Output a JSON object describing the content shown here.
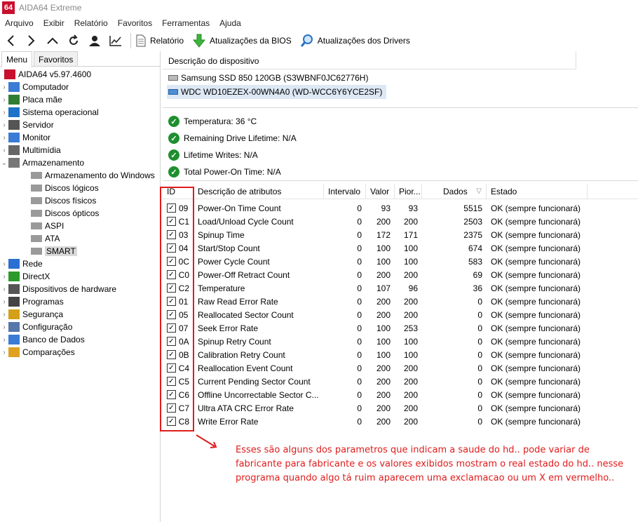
{
  "app": {
    "icon_text": "64",
    "title": "AIDA64 Extreme"
  },
  "menu": [
    "Arquivo",
    "Exibir",
    "Relatório",
    "Favoritos",
    "Ferramentas",
    "Ajuda"
  ],
  "toolbar": {
    "report_label": "Relatório",
    "bios_label": "Atualizações da BIOS",
    "drivers_label": "Atualizações dos Drivers"
  },
  "left_tabs": [
    "Menu",
    "Favoritos"
  ],
  "tree": {
    "root": "AIDA64 v5.97.4600",
    "items": [
      {
        "label": "Computador",
        "icon": "computer-icon",
        "color": "#3a7bd5"
      },
      {
        "label": "Placa mãe",
        "icon": "motherboard-icon",
        "color": "#2f7d32"
      },
      {
        "label": "Sistema operacional",
        "icon": "windows-icon",
        "color": "#1e73c8"
      },
      {
        "label": "Servidor",
        "icon": "server-icon",
        "color": "#555555"
      },
      {
        "label": "Monitor",
        "icon": "monitor-icon",
        "color": "#3a7bd5"
      },
      {
        "label": "Multimídia",
        "icon": "speaker-icon",
        "color": "#666666"
      },
      {
        "label": "Armazenamento",
        "icon": "storage-icon",
        "color": "#777777"
      }
    ],
    "storage_children": [
      "Armazenamento do Windows",
      "Discos lógicos",
      "Discos físicos",
      "Discos ópticos",
      "ASPI",
      "ATA",
      "SMART"
    ],
    "items_after": [
      {
        "label": "Rede",
        "icon": "network-icon",
        "color": "#2a6fd1"
      },
      {
        "label": "DirectX",
        "icon": "xbox-icon",
        "color": "#2b9a2b"
      },
      {
        "label": "Dispositivos de hardware",
        "icon": "hardware-icon",
        "color": "#555555"
      },
      {
        "label": "Programas",
        "icon": "programs-icon",
        "color": "#444444"
      },
      {
        "label": "Segurança",
        "icon": "shield-icon",
        "color": "#d4a017"
      },
      {
        "label": "Configuração",
        "icon": "config-icon",
        "color": "#5577aa"
      },
      {
        "label": "Banco de Dados",
        "icon": "database-icon",
        "color": "#3a7bd5"
      },
      {
        "label": "Comparações",
        "icon": "benchmark-icon",
        "color": "#e0a020"
      }
    ]
  },
  "device": {
    "header": "Descrição do dispositivo",
    "list": [
      "Samsung SSD 850 120GB (S3WBNF0JC62776H)",
      "WDC WD10EZEX-00WN4A0 (WD-WCC6Y6YCE2SF)"
    ]
  },
  "status": [
    "Temperatura: 36 °C",
    "Remaining Drive Lifetime: N/A",
    "Lifetime Writes: N/A",
    "Total Power-On Time: N/A"
  ],
  "table": {
    "headers": [
      "ID",
      "Descrição de atributos",
      "Intervalo",
      "Valor",
      "Pior...",
      "Dados",
      "Estado"
    ],
    "rows": [
      [
        "09",
        "Power-On Time Count",
        "0",
        "93",
        "93",
        "5515",
        "OK (sempre funcionará)"
      ],
      [
        "C1",
        "Load/Unload Cycle Count",
        "0",
        "200",
        "200",
        "2503",
        "OK (sempre funcionará)"
      ],
      [
        "03",
        "Spinup Time",
        "0",
        "172",
        "171",
        "2375",
        "OK (sempre funcionará)"
      ],
      [
        "04",
        "Start/Stop Count",
        "0",
        "100",
        "100",
        "674",
        "OK (sempre funcionará)"
      ],
      [
        "0C",
        "Power Cycle Count",
        "0",
        "100",
        "100",
        "583",
        "OK (sempre funcionará)"
      ],
      [
        "C0",
        "Power-Off Retract Count",
        "0",
        "200",
        "200",
        "69",
        "OK (sempre funcionará)"
      ],
      [
        "C2",
        "Temperature",
        "0",
        "107",
        "96",
        "36",
        "OK (sempre funcionará)"
      ],
      [
        "01",
        "Raw Read Error Rate",
        "0",
        "200",
        "200",
        "0",
        "OK (sempre funcionará)"
      ],
      [
        "05",
        "Reallocated Sector Count",
        "0",
        "200",
        "200",
        "0",
        "OK (sempre funcionará)"
      ],
      [
        "07",
        "Seek Error Rate",
        "0",
        "100",
        "253",
        "0",
        "OK (sempre funcionará)"
      ],
      [
        "0A",
        "Spinup Retry Count",
        "0",
        "100",
        "100",
        "0",
        "OK (sempre funcionará)"
      ],
      [
        "0B",
        "Calibration Retry Count",
        "0",
        "100",
        "100",
        "0",
        "OK (sempre funcionará)"
      ],
      [
        "C4",
        "Reallocation Event Count",
        "0",
        "200",
        "200",
        "0",
        "OK (sempre funcionará)"
      ],
      [
        "C5",
        "Current Pending Sector Count",
        "0",
        "200",
        "200",
        "0",
        "OK (sempre funcionará)"
      ],
      [
        "C6",
        "Offline Uncorrectable Sector C...",
        "0",
        "200",
        "200",
        "0",
        "OK (sempre funcionará)"
      ],
      [
        "C7",
        "Ultra ATA CRC Error Rate",
        "0",
        "200",
        "200",
        "0",
        "OK (sempre funcionará)"
      ],
      [
        "C8",
        "Write Error Rate",
        "0",
        "200",
        "200",
        "0",
        "OK (sempre funcionará)"
      ]
    ]
  },
  "annotation": {
    "color": "#e01c1c",
    "text": "Esses são alguns dos parametros que indicam a saude do hd.. pode variar de fabricante para fabricante e os valores exibidos mostram o real estado do hd.. nesse programa quando algo tá ruim aparecem uma exclamacao ou um X em vermelho.."
  }
}
